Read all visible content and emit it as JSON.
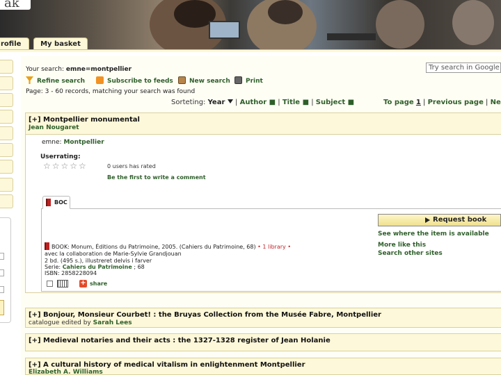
{
  "banner": {
    "logo": "ak"
  },
  "tabs": [
    {
      "label": "rofile"
    },
    {
      "label": "My basket"
    }
  ],
  "search": {
    "your_search_label": "Your search:",
    "query": "emne=montpellier",
    "google_placeholder": "Try search in Google - d"
  },
  "toolbar": {
    "refine": "Refine search",
    "subscribe": "Subscribe to feeds",
    "new_search": "New search",
    "print": "Print"
  },
  "results_info": {
    "text": "Page:  3  - 60 records, matching your search was found"
  },
  "sorting": {
    "label": "Sorteting:",
    "year": "Year",
    "author": "Author",
    "title": "Title",
    "subject": "Subject"
  },
  "pager": {
    "to_page": "To page",
    "page_num": "1",
    "previous": "Previous page",
    "next": "Ne"
  },
  "results": [
    {
      "title": "[+] Montpellier monumental",
      "author": "Jean Nougaret",
      "emne_label": "emne:",
      "emne_value": "Montpellier",
      "userrating_label": "Userrating:",
      "stars": "☆☆☆☆☆",
      "users_rated": "0 users has rated",
      "comment_link": "Be the first to write a comment",
      "tab_label": "BOC",
      "actions": {
        "request": "Request book",
        "where": "See where the item is available",
        "more": "More like this",
        "other": "Search other sites"
      },
      "book": {
        "line1_prefix": "BOOK: Monum, Éditions du Patrimoine, 2005. (Cahiers du Patrimoine, 68)",
        "line1_red": "• 1 library •",
        "line2": "avec la collaboration de Marie-Sylvie Grandjouan",
        "line3": "2 bd. (495 s.), illustreret delvis i farver",
        "line4_label": "Serie:",
        "line4_value": "Cahiers du Patrimoine",
        "line4_num": "; 68",
        "isbn": "ISBN: 2858228094",
        "share": "share"
      }
    },
    {
      "title": "[+] Bonjour, Monsieur Courbet! : the Bruyas Collection from the Musée Fabre, Montpellier",
      "author_prefix": "catalogue edited by",
      "author": "Sarah Lees"
    },
    {
      "title": "[+] Medieval notaries and their acts : the 1327-1328 register of Jean Holanie"
    },
    {
      "title": "[+] A cultural history of medical vitalism in enlightenment Montpellier",
      "author": "Elizabeth A. Williams"
    }
  ]
}
